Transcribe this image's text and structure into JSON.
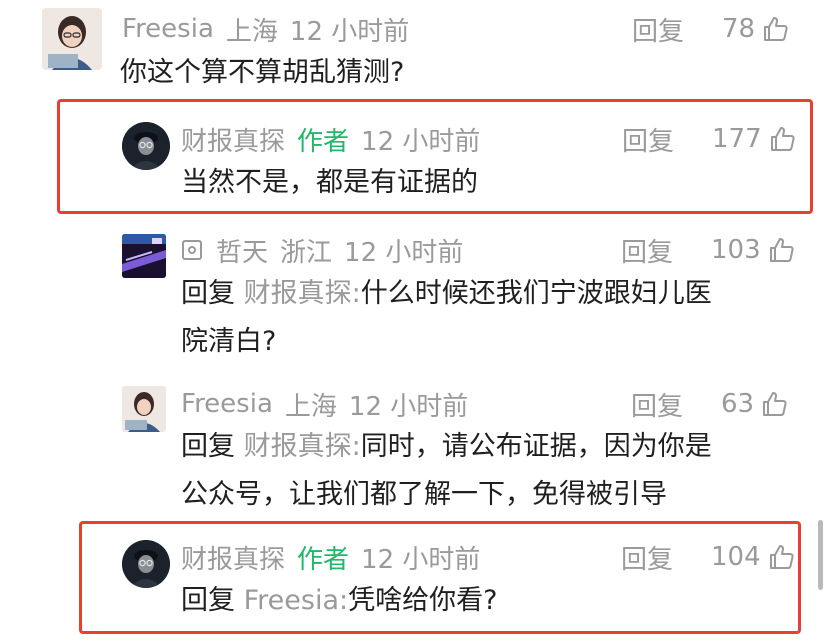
{
  "comments": [
    {
      "name": "Freesia",
      "location": "上海",
      "time": "12 小时前",
      "reply_label": "回复",
      "likes": "78",
      "text": "你这个算不算胡乱猜测?"
    },
    {
      "name": "财报真探",
      "author_badge": "作者",
      "time": "12 小时前",
      "reply_label": "回复",
      "likes": "177",
      "text": "当然不是，都是有证据的"
    },
    {
      "name": "哲天",
      "location": "浙江",
      "time": "12 小时前",
      "reply_label": "回复",
      "likes": "103",
      "reply_prefix": "回复",
      "reply_target": "财报真探:",
      "text_line1": "什么时候还我们宁波跟妇儿医",
      "text_line2": "院清白?"
    },
    {
      "name": "Freesia",
      "location": "上海",
      "time": "12 小时前",
      "reply_label": "回复",
      "likes": "63",
      "reply_prefix": "回复",
      "reply_target": "财报真探:",
      "text_line1": "同时，请公布证据，因为你是",
      "text_line2": "公众号，让我们都了解一下，免得被引导"
    },
    {
      "name": "财报真探",
      "author_badge": "作者",
      "time": "12 小时前",
      "reply_label": "回复",
      "likes": "104",
      "reply_prefix": "回复",
      "reply_target": "Freesia:",
      "text": "凭啥给你看?"
    }
  ],
  "colors": {
    "meta_gray": "#9a9a9a",
    "author_green": "#21b86a",
    "highlight_red": "#e8402f",
    "text_black": "#1f1f1f"
  },
  "icons": {
    "like": "thumbs-up-icon",
    "badge": "square-badge-icon"
  }
}
